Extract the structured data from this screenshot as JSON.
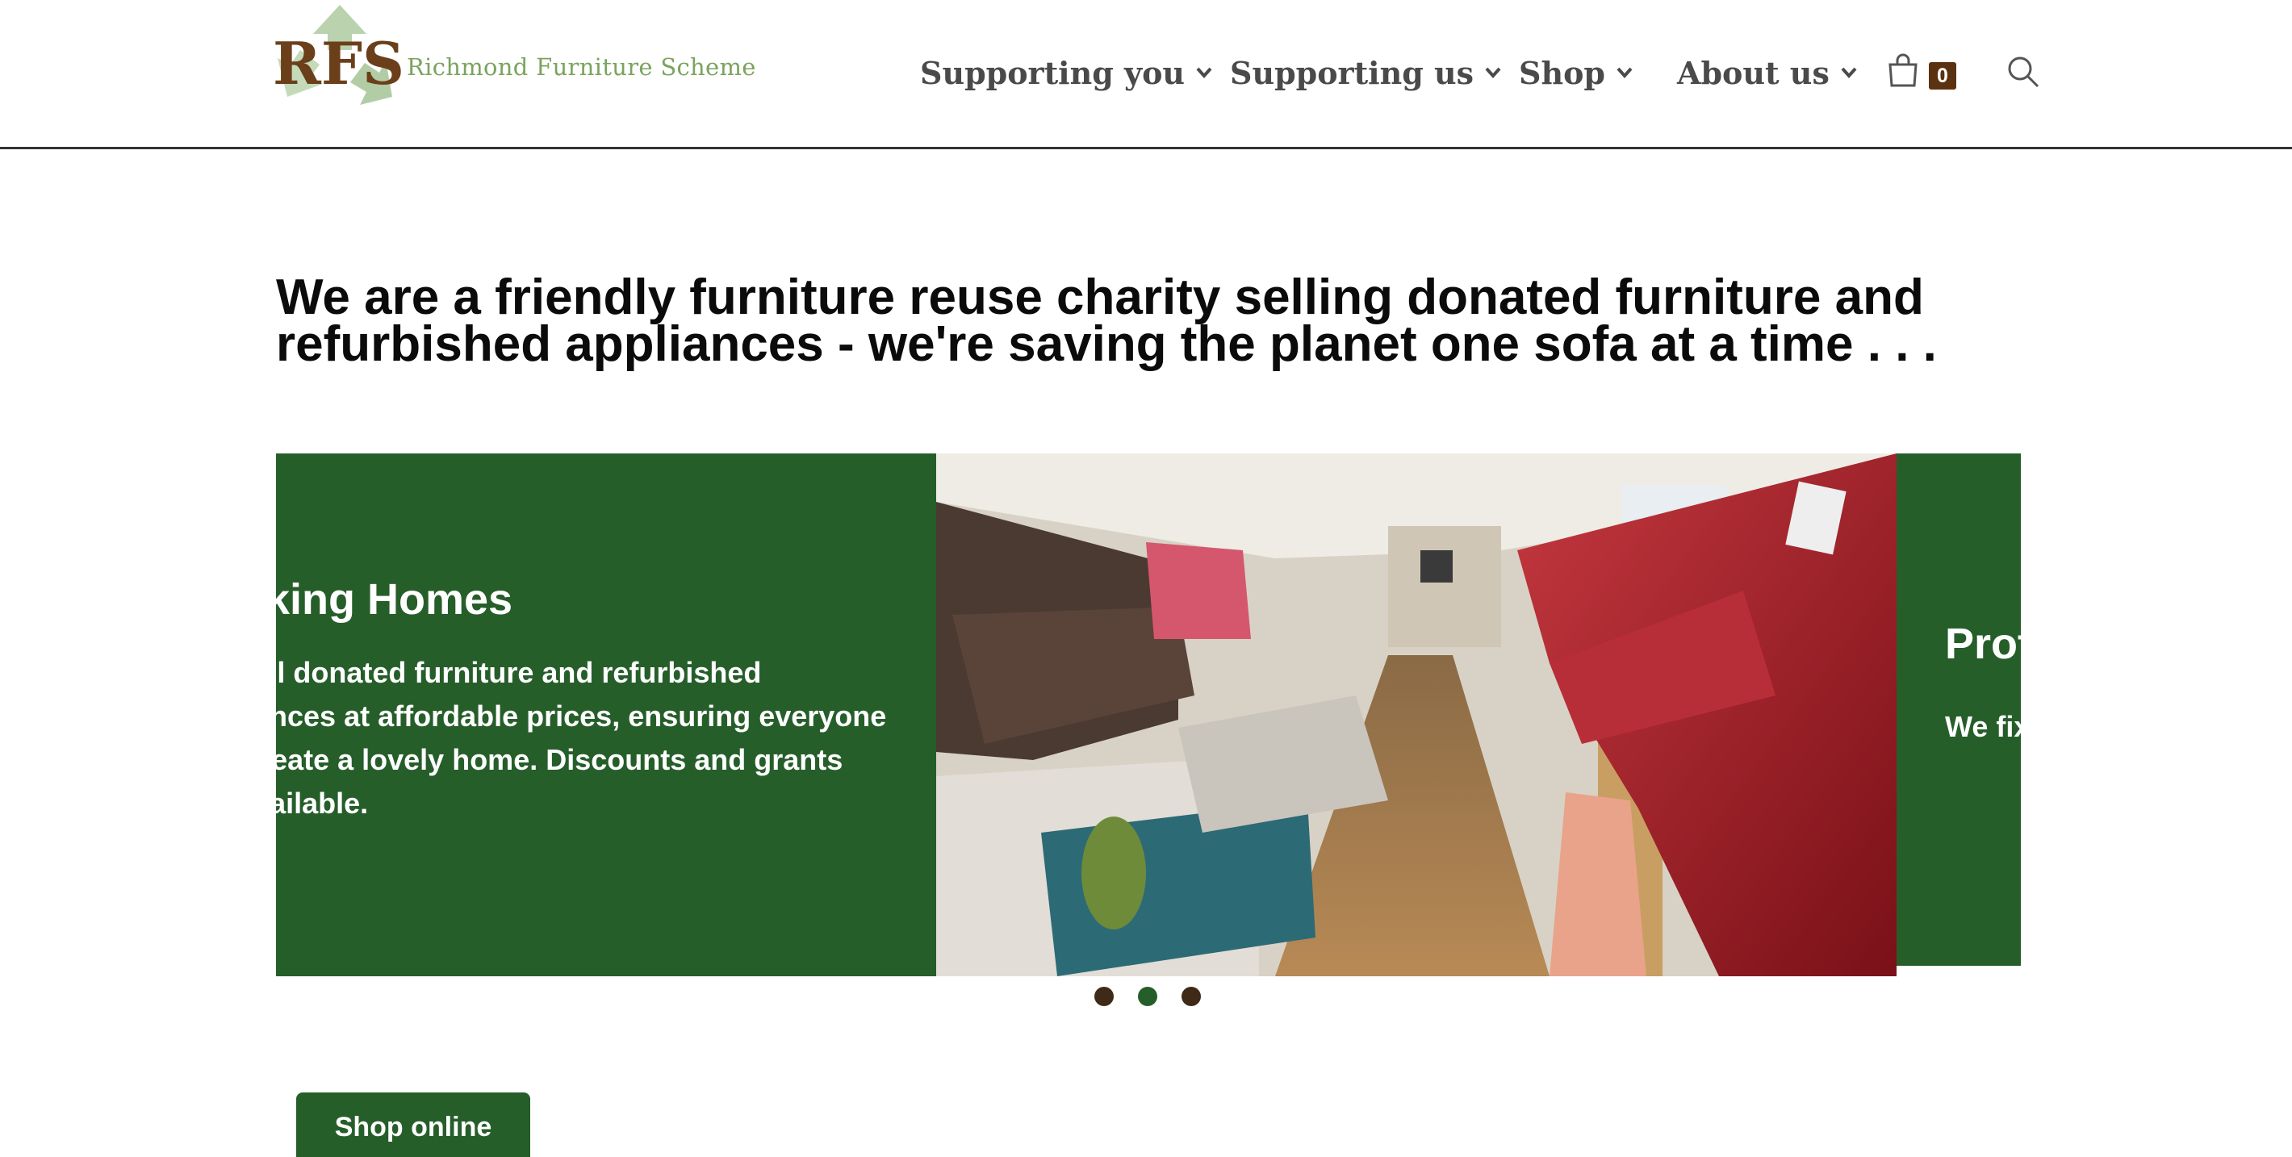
{
  "header": {
    "logo_mark": "RFS",
    "logo_name": "Richmond Furniture Scheme",
    "nav": [
      {
        "label": "Supporting you"
      },
      {
        "label": "Supporting us"
      },
      {
        "label": "Shop"
      },
      {
        "label": "About us"
      }
    ],
    "cart_count": "0",
    "icons": {
      "cart": "shopping-bag-icon",
      "search": "search-icon",
      "chevron": "chevron-down-icon"
    }
  },
  "hero": {
    "tagline": "We are a friendly furniture reuse charity selling donated furniture and refurbished appliances - we're saving the planet one sofa at a time . . ."
  },
  "carousel": {
    "current": {
      "title": "Making Homes",
      "body": "We sell donated furniture and refurbished appliances at affordable prices, ensuring everyone can create a lovely home. Discounts and grants are available."
    },
    "next": {
      "title": "Protecting",
      "body": "We fix and lease tonnes"
    },
    "dots": 3,
    "active_dot": 1
  },
  "cta": {
    "shop_label": "Shop online"
  },
  "colors": {
    "brand_green": "#265e2a",
    "brown": "#5b3210",
    "logo_green": "#7ba35e"
  }
}
